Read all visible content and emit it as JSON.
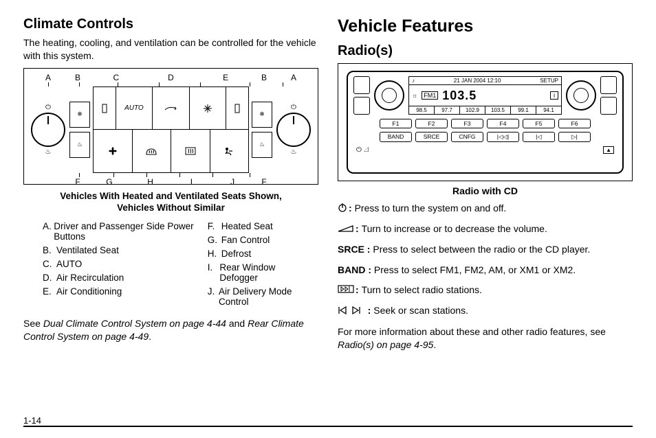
{
  "page_number": "1-14",
  "left": {
    "heading": "Climate Controls",
    "intro": "The heating, cooling, and ventilation can be controlled for the vehicle with this system.",
    "diagram": {
      "top_labels": [
        "A",
        "B",
        "C",
        "D",
        "E",
        "B",
        "A"
      ],
      "bottom_labels": [
        "F",
        "G",
        "H",
        "I",
        "J",
        "F"
      ],
      "auto_label": "AUTO"
    },
    "caption_line1": "Vehicles With Heated and Ventilated Seats Shown,",
    "caption_line2": "Vehicles Without Similar",
    "legend_left": [
      {
        "letter": "A.",
        "text": "Driver and Passenger Side Power Buttons"
      },
      {
        "letter": "B.",
        "text": "Ventilated Seat"
      },
      {
        "letter": "C.",
        "text": "AUTO"
      },
      {
        "letter": "D.",
        "text": "Air Recirculation"
      },
      {
        "letter": "E.",
        "text": "Air Conditioning"
      }
    ],
    "legend_right": [
      {
        "letter": "F.",
        "text": "Heated Seat"
      },
      {
        "letter": "G.",
        "text": "Fan Control"
      },
      {
        "letter": "H.",
        "text": "Defrost"
      },
      {
        "letter": "I.",
        "text": "Rear Window Defogger"
      },
      {
        "letter": "J.",
        "text": "Air Delivery Mode Control"
      }
    ],
    "see_prefix": "See ",
    "see_ref1": "Dual Climate Control System on page 4-44",
    "see_mid": " and ",
    "see_ref2": "Rear Climate Control System on page 4-49",
    "see_suffix": "."
  },
  "right": {
    "heading_big": "Vehicle Features",
    "heading": "Radio(s)",
    "radio": {
      "date": "21 JAN 2004 12:10",
      "setup": "SETUP",
      "music_icon": "♪",
      "band_label": "FM1",
      "freq": "103.5",
      "info_icon": "i",
      "presets": [
        "98.5",
        "97.7",
        "102.9",
        "103.5",
        "99.1",
        "94.1"
      ],
      "f_row": [
        "F1",
        "F2",
        "F3",
        "F4",
        "F5",
        "F6"
      ],
      "ctrl_row": [
        "BAND",
        "SRCE",
        "CNFG",
        "|◁◁|",
        "|◁",
        "▷|"
      ],
      "power_vol": "⏻ ◿",
      "eject": "⏏"
    },
    "radio_caption": "Radio with CD",
    "features": [
      {
        "icon": "power",
        "label": "",
        "sep": ":",
        "text": "Press to turn the system on and off."
      },
      {
        "icon": "volume",
        "label": "",
        "sep": ":",
        "text": "Turn to increase or to decrease the volume."
      },
      {
        "icon": "",
        "label": "SRCE",
        "sep": " : ",
        "text": "Press to select between the radio or the CD player."
      },
      {
        "icon": "",
        "label": "BAND",
        "sep": " : ",
        "text": "Press to select FM1, FM2, AM, or XM1 or XM2."
      },
      {
        "icon": "tune",
        "label": "",
        "sep": ":",
        "text": "Turn to select radio stations."
      },
      {
        "icon": "seek",
        "label": "",
        "sep": ":",
        "text": "Seek or scan stations."
      }
    ],
    "more_prefix": "For more information about these and other radio features, see ",
    "more_ref": "Radio(s) on page 4-95",
    "more_suffix": "."
  }
}
